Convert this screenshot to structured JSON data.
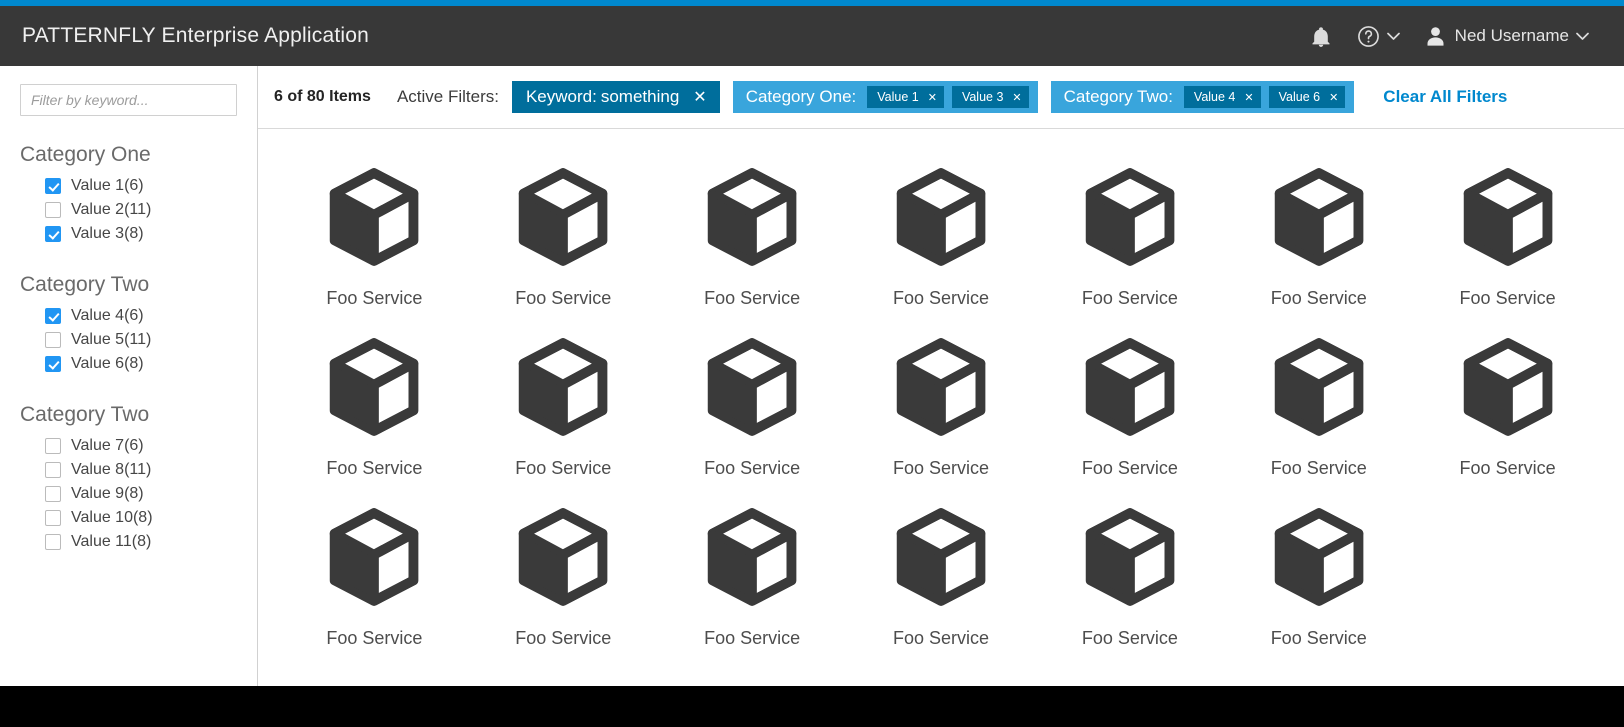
{
  "masthead": {
    "brand": "PATTERNFLY Enterprise Application",
    "accent_color": "#0088ce",
    "background": "#383838",
    "notifications_icon": "bell-icon",
    "help_icon": "question-circle-icon",
    "help_caret": "⌄",
    "user_icon": "user-avatar-icon",
    "username": "Ned Username",
    "user_caret": "⌄"
  },
  "sidebar": {
    "filter_input": {
      "placeholder": "Filter by keyword...",
      "value": ""
    },
    "groups": [
      {
        "title": "Category One",
        "options": [
          {
            "label": "Value 1(6)",
            "checked": true
          },
          {
            "label": "Value 2(11)",
            "checked": false
          },
          {
            "label": "Value 3(8)",
            "checked": true
          }
        ]
      },
      {
        "title": "Category Two",
        "options": [
          {
            "label": "Value 4(6)",
            "checked": true
          },
          {
            "label": "Value 5(11)",
            "checked": false
          },
          {
            "label": "Value 6(8)",
            "checked": true
          }
        ]
      },
      {
        "title": "Category Two",
        "options": [
          {
            "label": "Value 7(6)",
            "checked": false
          },
          {
            "label": "Value 8(11)",
            "checked": false
          },
          {
            "label": "Value 9(8)",
            "checked": false
          },
          {
            "label": "Value 10(8)",
            "checked": false
          },
          {
            "label": "Value 11(8)",
            "checked": false
          }
        ]
      }
    ]
  },
  "toolbar": {
    "item_count": "6 of 80 Items",
    "active_filters_label": "Active Filters:",
    "keyword_chip": {
      "key": "Keyword:",
      "value": "something",
      "remove": "✕",
      "background": "#006e9c"
    },
    "filter_groups": [
      {
        "label": "Category One:",
        "background": "#39a5dc",
        "chips": [
          {
            "label": "Value 1",
            "remove": "✕"
          },
          {
            "label": "Value 3",
            "remove": "✕"
          }
        ]
      },
      {
        "label": "Category Two:",
        "background": "#39a5dc",
        "chips": [
          {
            "label": "Value 4",
            "remove": "✕"
          },
          {
            "label": "Value 6",
            "remove": "✕"
          }
        ]
      }
    ],
    "clear_all": "Clear All Filters",
    "clear_all_color": "#0088ce"
  },
  "grid": {
    "icon_name": "cube-icon",
    "icon_color": "#3a3a3a",
    "columns": 7,
    "cards": [
      {
        "label": "Foo Service"
      },
      {
        "label": "Foo Service"
      },
      {
        "label": "Foo Service"
      },
      {
        "label": "Foo Service"
      },
      {
        "label": "Foo Service"
      },
      {
        "label": "Foo Service"
      },
      {
        "label": "Foo Service"
      },
      {
        "label": "Foo Service"
      },
      {
        "label": "Foo Service"
      },
      {
        "label": "Foo Service"
      },
      {
        "label": "Foo Service"
      },
      {
        "label": "Foo Service"
      },
      {
        "label": "Foo Service"
      },
      {
        "label": "Foo Service"
      },
      {
        "label": "Foo Service"
      },
      {
        "label": "Foo Service"
      },
      {
        "label": "Foo Service"
      },
      {
        "label": "Foo Service"
      },
      {
        "label": "Foo Service"
      },
      {
        "label": "Foo Service"
      }
    ]
  }
}
